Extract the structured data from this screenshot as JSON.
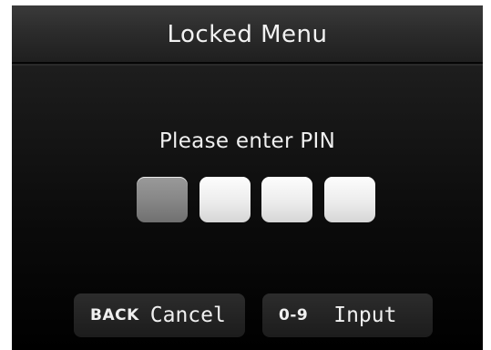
{
  "title": "Locked Menu",
  "prompt": "Please enter PIN",
  "pin": {
    "digits_total": 4,
    "active_index": 0
  },
  "softkeys": {
    "back": {
      "hint": "BACK",
      "action": "Cancel"
    },
    "input": {
      "hint": "0-9",
      "action": "Input"
    }
  },
  "colors": {
    "screen_background": "#000000",
    "pin_box": "#eeeeee",
    "pin_box_active": "#858585",
    "text": "#f0f0f0"
  }
}
